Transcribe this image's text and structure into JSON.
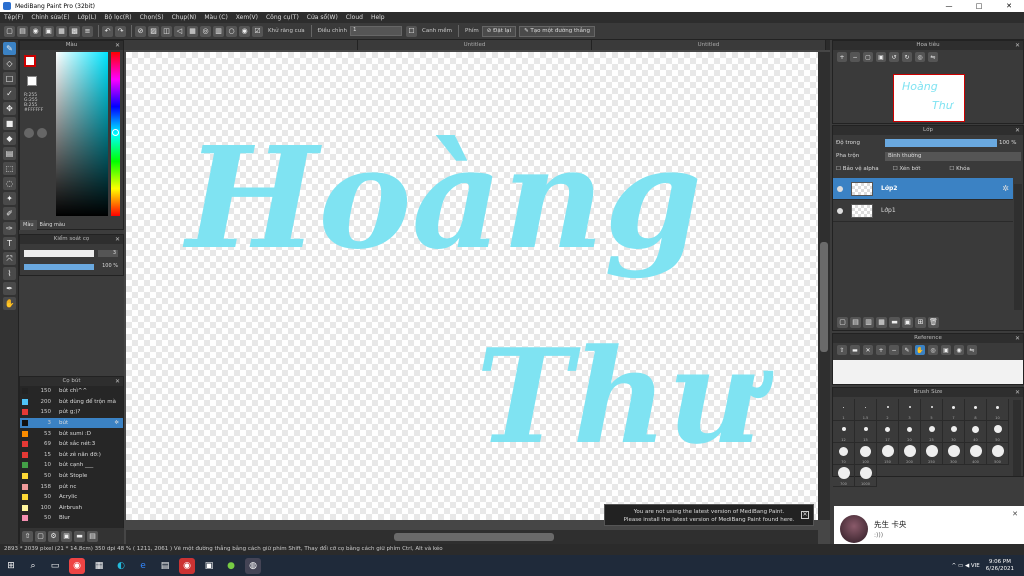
{
  "app": {
    "title": "MediBang Paint Pro (32bit)",
    "min": "—",
    "max": "□",
    "close": "✕"
  },
  "menu": [
    "Tệp(F)",
    "Chỉnh sửa(E)",
    "Lớp(L)",
    "Bộ lọc(R)",
    "Chọn(S)",
    "Chụp(N)",
    "Màu (C)",
    "Xem(V)",
    "Công cụ(T)",
    "Cửa sổ(W)",
    "Cloud",
    "Help"
  ],
  "toolbar": {
    "anti_alias": "Khử răng cưa",
    "correction_label": "Điều chỉnh",
    "correction_value": "1",
    "snap_label": "Canh mềm",
    "snap_prefix": "Phím",
    "snap_off": "Đặt lại",
    "line_mode": "Tạo một đường thẳng"
  },
  "tabs": [
    "",
    "Untitled",
    "Untitled"
  ],
  "color_panel": {
    "title": "Màu",
    "r": "R:255",
    "g": "G:255",
    "b": "B:255",
    "hex": "#FFFFFF",
    "tab_color": "Màu",
    "tab_palette": "Bảng màu"
  },
  "brush_control": {
    "title": "Kiểm soát cọ",
    "size_value": "3",
    "opacity_value": "100 %",
    "opacity_fraction": 1.0
  },
  "brush_list": {
    "title": "Cọ bút",
    "items": [
      {
        "size": "150",
        "name": "bút chì^^",
        "color": "#222222"
      },
      {
        "size": "200",
        "name": "bút dùng để trộn mà",
        "color": "#4fc3f7"
      },
      {
        "size": "150",
        "name": "pút g;)?",
        "color": "#e53935"
      },
      {
        "size": "3",
        "name": "bút",
        "color": "#111111",
        "selected": true
      },
      {
        "size": "53",
        "name": "bút sumi :D",
        "color": "#fb8c00"
      },
      {
        "size": "69",
        "name": "bút sắc nét:3",
        "color": "#e53935"
      },
      {
        "size": "15",
        "name": "bút zê nân đỡ:)",
        "color": "#e53935"
      },
      {
        "size": "10",
        "name": "bút cạnh ___",
        "color": "#43a047"
      },
      {
        "size": "50",
        "name": "bút Stople",
        "color": "#fdd835"
      },
      {
        "size": "158",
        "name": "pút nc",
        "color": "#ef9a9a"
      },
      {
        "size": "50",
        "name": "Acrylic",
        "color": "#fdd835"
      },
      {
        "size": "100",
        "name": "Airbrush",
        "color": "#fff59d"
      },
      {
        "size": "50",
        "name": "Blur",
        "color": "#f48fb1"
      }
    ]
  },
  "navigator": {
    "title": "Hoa tiêu"
  },
  "layer_panel": {
    "title": "Lớp",
    "opacity_label": "Độ trong",
    "opacity_value": "100 %",
    "opacity_fraction": 1.0,
    "blend_label": "Pha trộn",
    "blend_value": "Bình thường",
    "protect_alpha": "Bảo vệ alpha",
    "clipping": "Xén bớt",
    "lock": "Khóa",
    "layers": [
      {
        "name": "Lớp2",
        "selected": true
      },
      {
        "name": "Lớp1",
        "selected": false
      }
    ]
  },
  "reference": {
    "title": "Reference"
  },
  "brush_size": {
    "title": "Brush Size",
    "sizes": [
      "1",
      "1.5",
      "2",
      "3",
      "5",
      "7",
      "8",
      "10",
      "12",
      "15",
      "17",
      "20",
      "25",
      "30",
      "40",
      "50",
      "70",
      "100",
      "150",
      "200",
      "250",
      "300",
      "400",
      "500",
      "700",
      "1000"
    ]
  },
  "canvas_text": {
    "line1": "Hoàng",
    "line2": "Thư",
    "color": "#7fe3f2"
  },
  "notice": {
    "line1": "You are not using the latest version of MediBang Paint.",
    "line2": "Please install the latest version of MediBang Paint found here."
  },
  "status": "2893 * 2039 pixel (21 * 14.8cm) 350 dpi 48 % ( 1211, 2061 ) Vẽ một đường thẳng bằng cách giữ phím Shift, Thay đổi cỡ cọ bằng cách giữ phím Ctrl, Alt và kéo",
  "chat": {
    "name": "先生 卡央",
    "message": ":)))"
  },
  "tray": {
    "lang": "VIE",
    "time": "9:06 PM",
    "date": "6/26/2021"
  }
}
